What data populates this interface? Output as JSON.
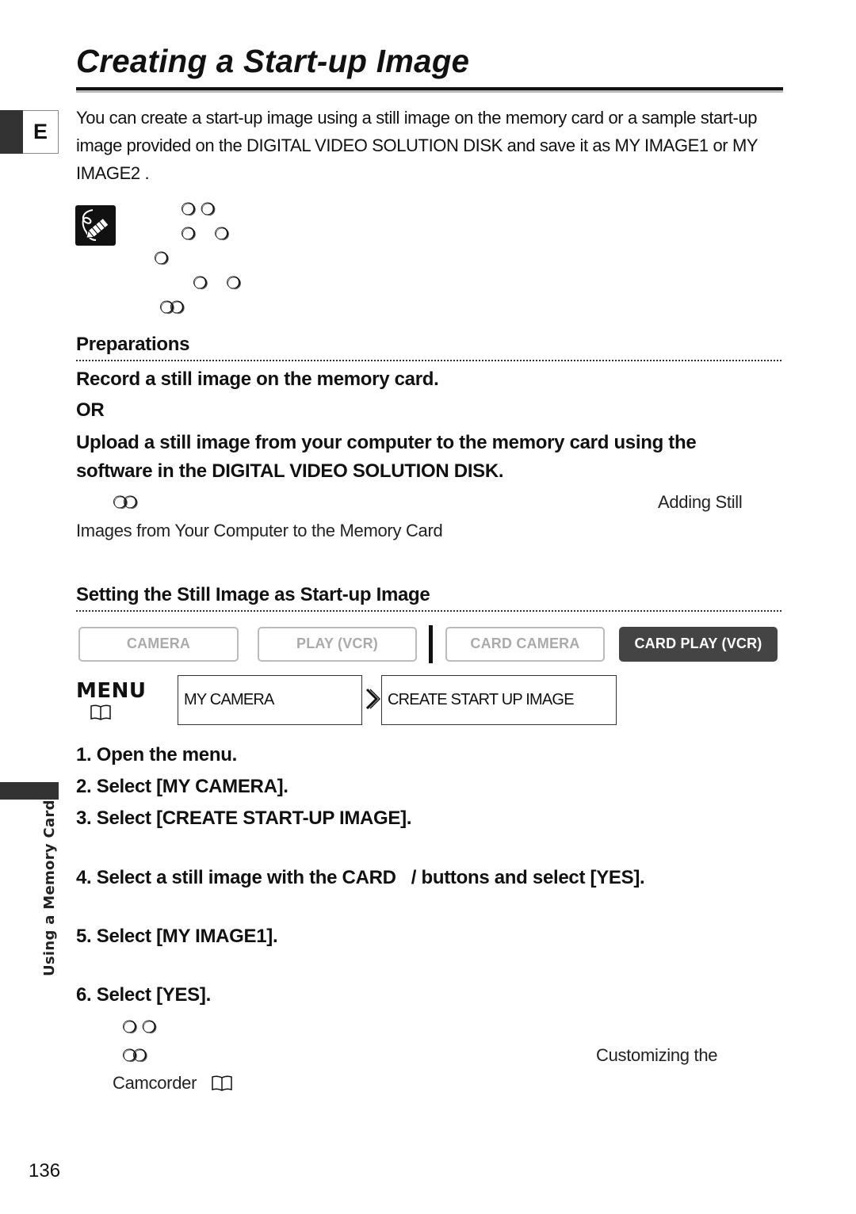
{
  "page": {
    "title": "Creating a Start-up Image",
    "language_tab": "E",
    "intro": "You can create a start-up image using a still image on the memory card or a sample start-up image provided on the DIGITAL VIDEO SOLUTION DISK and save it as  MY IMAGE1  or  MY IMAGE2 .",
    "note_icon": "note-pencil-icon",
    "note_glyphs": [
      "❍ ❍",
      "❍    ❍",
      "❍",
      "❍    ❍",
      "❍❍"
    ],
    "preparations": {
      "heading": "Preparations",
      "line1": "Record a still image on the memory card.",
      "or": "OR",
      "line2": "Upload a still image from your computer to the memory card using the software in the DIGITAL VIDEO SOLUTION DISK.",
      "ref_glyph": "❍❍",
      "ref_text_a": "Adding Still",
      "ref_text_b": "Images from Your Computer to the Memory Card"
    },
    "setting": {
      "heading": "Setting the Still Image as Start-up Image",
      "modes": [
        {
          "label": "CAMERA",
          "active": false
        },
        {
          "label": "PLAY (VCR)",
          "active": false
        },
        {
          "label": "CARD CAMERA",
          "active": false
        },
        {
          "label": "CARD PLAY (VCR)",
          "active": true
        }
      ],
      "menu_label": "MENU",
      "book_icon": "📖",
      "menu_path": [
        "MY CAMERA",
        "CREATE START UP IMAGE"
      ],
      "arrow": "❯"
    },
    "steps": [
      "1. Open the menu.",
      "2. Select [MY CAMERA].",
      "3. Select [CREATE START-UP IMAGE].",
      "4. Select a still image with the CARD   / buttons and select [YES].",
      "5. Select [MY IMAGE1].",
      "6. Select [YES]."
    ],
    "after_steps": {
      "glyph1": "❍ ❍",
      "glyph2": "❍❍",
      "ref_text_a": "Customizing the",
      "ref_text_b": "Camcorder"
    },
    "side_label": "Using a Memory Card",
    "page_number": "136"
  }
}
